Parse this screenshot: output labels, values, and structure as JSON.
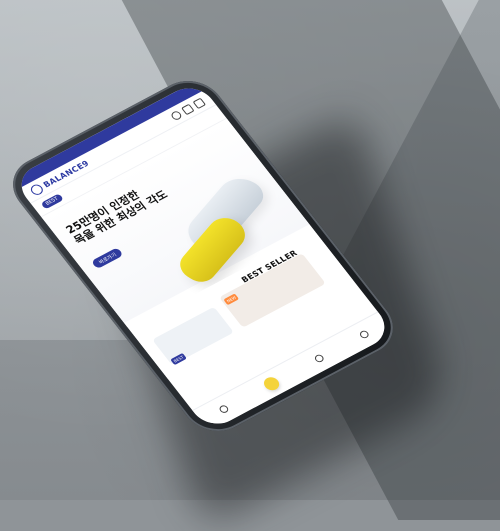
{
  "colors": {
    "brand": "#2f3a9e",
    "accent_yellow": "#f4d33a",
    "concrete": "#8f9498"
  },
  "header": {
    "logo_text": "BALANCE9"
  },
  "nav": {
    "active_pill": "BEST"
  },
  "hero": {
    "title_line1": "25만명이 인정한",
    "title_line2": "목을 위한 최상의 각도",
    "button_label": "바로가기"
  },
  "best_seller": {
    "title": "BEST SELLER",
    "badge_left": "BEST",
    "badge_right": "NEW"
  },
  "icons": [
    "search-icon",
    "cart-icon",
    "menu-icon",
    "home-icon",
    "category-icon",
    "my-icon"
  ]
}
